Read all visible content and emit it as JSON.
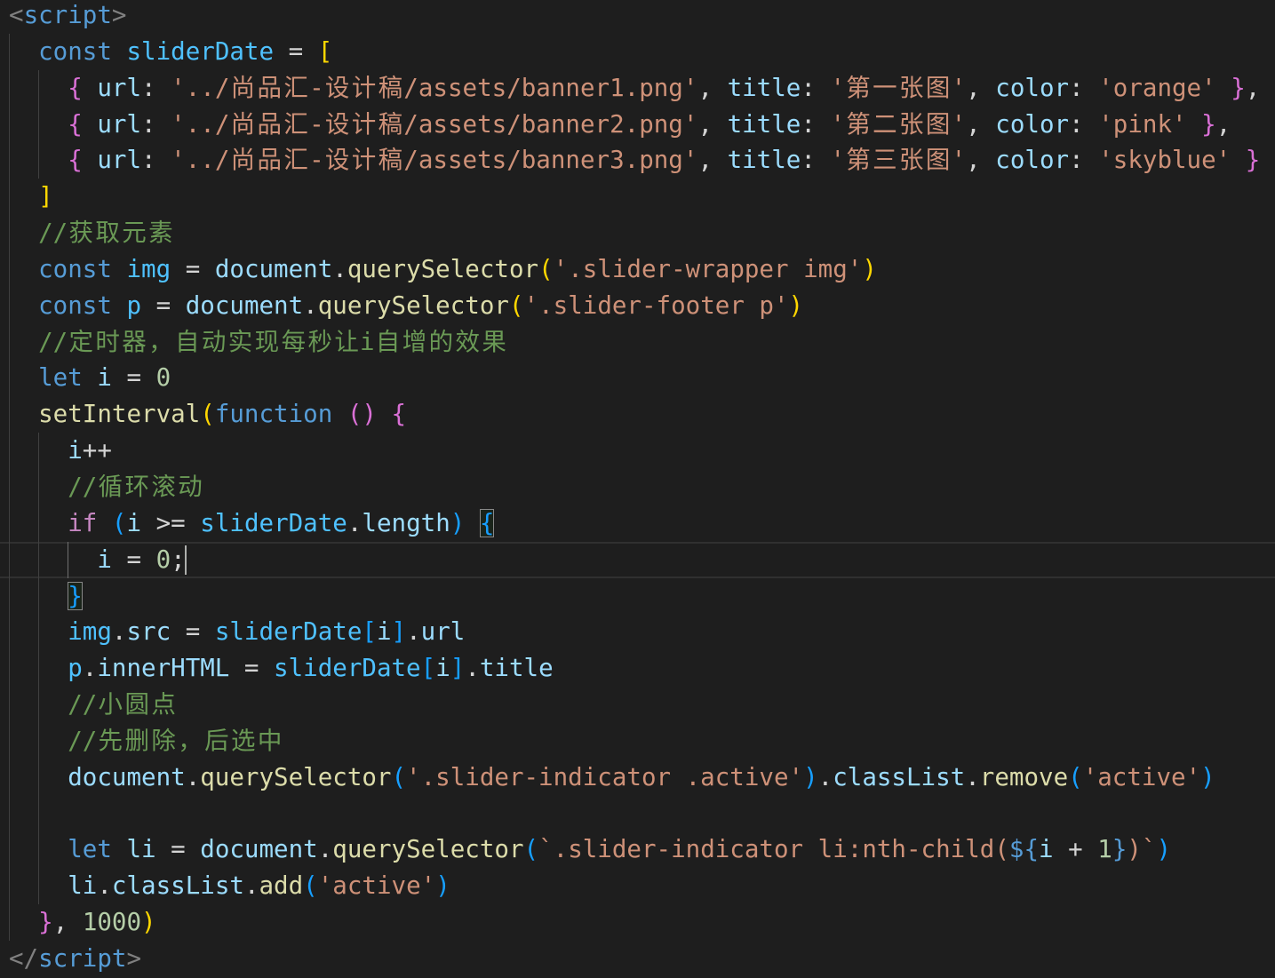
{
  "theme": {
    "editor_background": "#1e1e1e",
    "line_highlight_border": "#303030",
    "indent_guide": "#404040",
    "active_indent_guide": "#707070",
    "bracket_match_border": "#888888",
    "cursor": "#aeafad"
  },
  "code": {
    "lines": [
      [
        [
          "<",
          "#808080"
        ],
        [
          "script",
          "#569cd6"
        ],
        [
          ">",
          "#808080"
        ]
      ],
      [
        [
          "  ",
          "#d4d4d4"
        ],
        [
          "const",
          "#569cd6"
        ],
        [
          " ",
          "#d4d4d4"
        ],
        [
          "sliderDate",
          "#4fc1ff"
        ],
        [
          " = ",
          "#d4d4d4"
        ],
        [
          "[",
          "#ffd700"
        ]
      ],
      [
        [
          "    ",
          "#d4d4d4"
        ],
        [
          "{",
          "#da70d6"
        ],
        [
          " ",
          "#d4d4d4"
        ],
        [
          "url",
          "#9cdcfe"
        ],
        [
          ": ",
          "#d4d4d4"
        ],
        [
          "'../尚品汇-设计稿/assets/banner1.png'",
          "#ce9178"
        ],
        [
          ", ",
          "#d4d4d4"
        ],
        [
          "title",
          "#9cdcfe"
        ],
        [
          ": ",
          "#d4d4d4"
        ],
        [
          "'第一张图'",
          "#ce9178"
        ],
        [
          ", ",
          "#d4d4d4"
        ],
        [
          "color",
          "#9cdcfe"
        ],
        [
          ": ",
          "#d4d4d4"
        ],
        [
          "'orange'",
          "#ce9178"
        ],
        [
          " ",
          "#d4d4d4"
        ],
        [
          "}",
          "#da70d6"
        ],
        [
          ",",
          "#d4d4d4"
        ]
      ],
      [
        [
          "    ",
          "#d4d4d4"
        ],
        [
          "{",
          "#da70d6"
        ],
        [
          " ",
          "#d4d4d4"
        ],
        [
          "url",
          "#9cdcfe"
        ],
        [
          ": ",
          "#d4d4d4"
        ],
        [
          "'../尚品汇-设计稿/assets/banner2.png'",
          "#ce9178"
        ],
        [
          ", ",
          "#d4d4d4"
        ],
        [
          "title",
          "#9cdcfe"
        ],
        [
          ": ",
          "#d4d4d4"
        ],
        [
          "'第二张图'",
          "#ce9178"
        ],
        [
          ", ",
          "#d4d4d4"
        ],
        [
          "color",
          "#9cdcfe"
        ],
        [
          ": ",
          "#d4d4d4"
        ],
        [
          "'pink'",
          "#ce9178"
        ],
        [
          " ",
          "#d4d4d4"
        ],
        [
          "}",
          "#da70d6"
        ],
        [
          ",",
          "#d4d4d4"
        ]
      ],
      [
        [
          "    ",
          "#d4d4d4"
        ],
        [
          "{",
          "#da70d6"
        ],
        [
          " ",
          "#d4d4d4"
        ],
        [
          "url",
          "#9cdcfe"
        ],
        [
          ": ",
          "#d4d4d4"
        ],
        [
          "'../尚品汇-设计稿/assets/banner3.png'",
          "#ce9178"
        ],
        [
          ", ",
          "#d4d4d4"
        ],
        [
          "title",
          "#9cdcfe"
        ],
        [
          ": ",
          "#d4d4d4"
        ],
        [
          "'第三张图'",
          "#ce9178"
        ],
        [
          ", ",
          "#d4d4d4"
        ],
        [
          "color",
          "#9cdcfe"
        ],
        [
          ": ",
          "#d4d4d4"
        ],
        [
          "'skyblue'",
          "#ce9178"
        ],
        [
          " ",
          "#d4d4d4"
        ],
        [
          "}",
          "#da70d6"
        ]
      ],
      [
        [
          "  ",
          "#d4d4d4"
        ],
        [
          "]",
          "#ffd700"
        ]
      ],
      [
        [
          "  ",
          "#d4d4d4"
        ],
        [
          "//获取元素",
          "#6a9955"
        ]
      ],
      [
        [
          "  ",
          "#d4d4d4"
        ],
        [
          "const",
          "#569cd6"
        ],
        [
          " ",
          "#d4d4d4"
        ],
        [
          "img",
          "#4fc1ff"
        ],
        [
          " = ",
          "#d4d4d4"
        ],
        [
          "document",
          "#9cdcfe"
        ],
        [
          ".",
          "#d4d4d4"
        ],
        [
          "querySelector",
          "#dcdcaa"
        ],
        [
          "(",
          "#ffd700"
        ],
        [
          "'.slider-wrapper img'",
          "#ce9178"
        ],
        [
          ")",
          "#ffd700"
        ]
      ],
      [
        [
          "  ",
          "#d4d4d4"
        ],
        [
          "const",
          "#569cd6"
        ],
        [
          " ",
          "#d4d4d4"
        ],
        [
          "p",
          "#4fc1ff"
        ],
        [
          " = ",
          "#d4d4d4"
        ],
        [
          "document",
          "#9cdcfe"
        ],
        [
          ".",
          "#d4d4d4"
        ],
        [
          "querySelector",
          "#dcdcaa"
        ],
        [
          "(",
          "#ffd700"
        ],
        [
          "'.slider-footer p'",
          "#ce9178"
        ],
        [
          ")",
          "#ffd700"
        ]
      ],
      [
        [
          "  ",
          "#d4d4d4"
        ],
        [
          "//定时器，自动实现每秒让i自增的效果",
          "#6a9955"
        ]
      ],
      [
        [
          "  ",
          "#d4d4d4"
        ],
        [
          "let",
          "#569cd6"
        ],
        [
          " ",
          "#d4d4d4"
        ],
        [
          "i",
          "#9cdcfe"
        ],
        [
          " = ",
          "#d4d4d4"
        ],
        [
          "0",
          "#b5cea8"
        ]
      ],
      [
        [
          "  ",
          "#d4d4d4"
        ],
        [
          "setInterval",
          "#dcdcaa"
        ],
        [
          "(",
          "#ffd700"
        ],
        [
          "function",
          "#569cd6"
        ],
        [
          " ",
          "#d4d4d4"
        ],
        [
          "()",
          "#da70d6"
        ],
        [
          " ",
          "#d4d4d4"
        ],
        [
          "{",
          "#da70d6"
        ]
      ],
      [
        [
          "    ",
          "#d4d4d4"
        ],
        [
          "i",
          "#9cdcfe"
        ],
        [
          "++",
          "#d4d4d4"
        ]
      ],
      [
        [
          "    ",
          "#d4d4d4"
        ],
        [
          "//循环滚动",
          "#6a9955"
        ]
      ],
      [
        [
          "    ",
          "#d4d4d4"
        ],
        [
          "if",
          "#c586c0"
        ],
        [
          " ",
          "#d4d4d4"
        ],
        [
          "(",
          "#179fff"
        ],
        [
          "i",
          "#9cdcfe"
        ],
        [
          " >= ",
          "#d4d4d4"
        ],
        [
          "sliderDate",
          "#4fc1ff"
        ],
        [
          ".",
          "#d4d4d4"
        ],
        [
          "length",
          "#9cdcfe"
        ],
        [
          ")",
          "#179fff"
        ],
        [
          " ",
          "#d4d4d4"
        ],
        [
          "{",
          "#179fff",
          true
        ]
      ],
      [
        [
          "      ",
          "#d4d4d4"
        ],
        [
          "i",
          "#9cdcfe"
        ],
        [
          " = ",
          "#d4d4d4"
        ],
        [
          "0",
          "#b5cea8"
        ],
        [
          ";",
          "#d4d4d4"
        ]
      ],
      [
        [
          "    ",
          "#d4d4d4"
        ],
        [
          "}",
          "#179fff",
          true
        ]
      ],
      [
        [
          "    ",
          "#d4d4d4"
        ],
        [
          "img",
          "#4fc1ff"
        ],
        [
          ".",
          "#d4d4d4"
        ],
        [
          "src",
          "#9cdcfe"
        ],
        [
          " = ",
          "#d4d4d4"
        ],
        [
          "sliderDate",
          "#4fc1ff"
        ],
        [
          "[",
          "#179fff"
        ],
        [
          "i",
          "#9cdcfe"
        ],
        [
          "]",
          "#179fff"
        ],
        [
          ".",
          "#d4d4d4"
        ],
        [
          "url",
          "#9cdcfe"
        ]
      ],
      [
        [
          "    ",
          "#d4d4d4"
        ],
        [
          "p",
          "#4fc1ff"
        ],
        [
          ".",
          "#d4d4d4"
        ],
        [
          "innerHTML",
          "#9cdcfe"
        ],
        [
          " = ",
          "#d4d4d4"
        ],
        [
          "sliderDate",
          "#4fc1ff"
        ],
        [
          "[",
          "#179fff"
        ],
        [
          "i",
          "#9cdcfe"
        ],
        [
          "]",
          "#179fff"
        ],
        [
          ".",
          "#d4d4d4"
        ],
        [
          "title",
          "#9cdcfe"
        ]
      ],
      [
        [
          "    ",
          "#d4d4d4"
        ],
        [
          "//小圆点",
          "#6a9955"
        ]
      ],
      [
        [
          "    ",
          "#d4d4d4"
        ],
        [
          "//先删除，后选中",
          "#6a9955"
        ]
      ],
      [
        [
          "    ",
          "#d4d4d4"
        ],
        [
          "document",
          "#9cdcfe"
        ],
        [
          ".",
          "#d4d4d4"
        ],
        [
          "querySelector",
          "#dcdcaa"
        ],
        [
          "(",
          "#179fff"
        ],
        [
          "'.slider-indicator .active'",
          "#ce9178"
        ],
        [
          ")",
          "#179fff"
        ],
        [
          ".",
          "#d4d4d4"
        ],
        [
          "classList",
          "#9cdcfe"
        ],
        [
          ".",
          "#d4d4d4"
        ],
        [
          "remove",
          "#dcdcaa"
        ],
        [
          "(",
          "#179fff"
        ],
        [
          "'active'",
          "#ce9178"
        ],
        [
          ")",
          "#179fff"
        ]
      ],
      [],
      [
        [
          "    ",
          "#d4d4d4"
        ],
        [
          "let",
          "#569cd6"
        ],
        [
          " ",
          "#d4d4d4"
        ],
        [
          "li",
          "#9cdcfe"
        ],
        [
          " = ",
          "#d4d4d4"
        ],
        [
          "document",
          "#9cdcfe"
        ],
        [
          ".",
          "#d4d4d4"
        ],
        [
          "querySelector",
          "#dcdcaa"
        ],
        [
          "(",
          "#179fff"
        ],
        [
          "`.slider-indicator li:nth-child(",
          "#ce9178"
        ],
        [
          "${",
          "#569cd6"
        ],
        [
          "i",
          "#9cdcfe"
        ],
        [
          " + ",
          "#d4d4d4"
        ],
        [
          "1",
          "#b5cea8"
        ],
        [
          "}",
          "#569cd6"
        ],
        [
          ")`",
          "#ce9178"
        ],
        [
          ")",
          "#179fff"
        ]
      ],
      [
        [
          "    ",
          "#d4d4d4"
        ],
        [
          "li",
          "#9cdcfe"
        ],
        [
          ".",
          "#d4d4d4"
        ],
        [
          "classList",
          "#9cdcfe"
        ],
        [
          ".",
          "#d4d4d4"
        ],
        [
          "add",
          "#dcdcaa"
        ],
        [
          "(",
          "#179fff"
        ],
        [
          "'active'",
          "#ce9178"
        ],
        [
          ")",
          "#179fff"
        ]
      ],
      [
        [
          "  ",
          "#d4d4d4"
        ],
        [
          "}",
          "#da70d6"
        ],
        [
          ", ",
          "#d4d4d4"
        ],
        [
          "1000",
          "#b5cea8"
        ],
        [
          ")",
          "#ffd700"
        ]
      ],
      [
        [
          "</",
          "#808080"
        ],
        [
          "script",
          "#569cd6"
        ],
        [
          ">",
          "#808080"
        ]
      ]
    ]
  }
}
